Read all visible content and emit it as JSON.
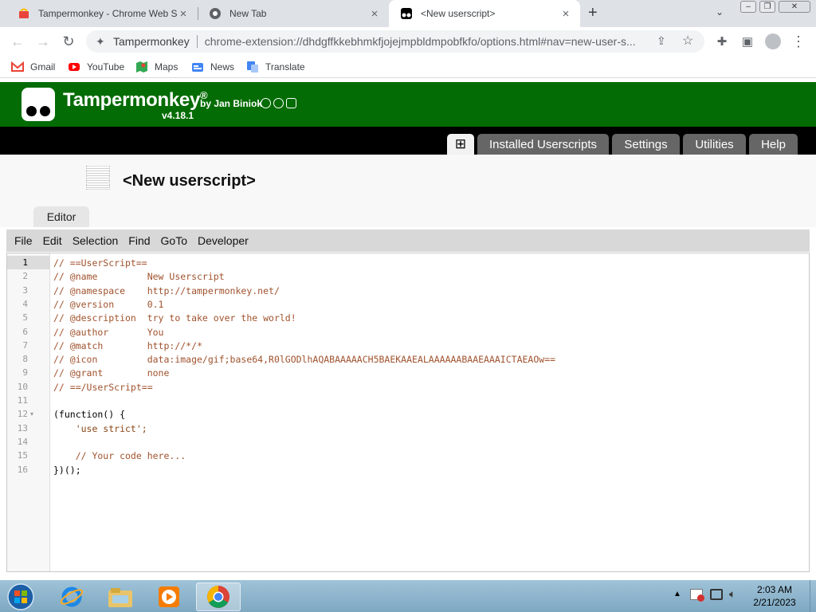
{
  "browser": {
    "tabs": [
      {
        "title": "Tampermonkey - Chrome Web St",
        "icon": "chrome-web-store-icon"
      },
      {
        "title": "New Tab",
        "icon": "chrome-icon"
      },
      {
        "title": "<New userscript>",
        "icon": "tampermonkey-icon",
        "active": true
      }
    ],
    "new_tab_symbol": "+",
    "close_symbol": "×",
    "omnibox": {
      "site": "Tampermonkey",
      "url": "chrome-extension://dhdgffkkebhmkfjojejmpbldmpobfkfo/options.html#nav=new-user-s..."
    },
    "bookmarks": [
      {
        "label": "Gmail",
        "icon": "gmail-icon",
        "color": "#ea4335"
      },
      {
        "label": "YouTube",
        "icon": "youtube-icon",
        "color": "#ff0000"
      },
      {
        "label": "Maps",
        "icon": "maps-icon",
        "color": "#34a853"
      },
      {
        "label": "News",
        "icon": "news-icon",
        "color": "#4285f4"
      },
      {
        "label": "Translate",
        "icon": "translate-icon",
        "color": "#4285f4"
      }
    ]
  },
  "tampermonkey": {
    "brand": "Tampermonkey",
    "registered": "®",
    "author": "by Jan Biniok",
    "version": "v4.18.1",
    "brand_color": "#046c04",
    "nav": {
      "new_symbol": "⊞",
      "items": [
        "Installed Userscripts",
        "Settings",
        "Utilities",
        "Help"
      ]
    },
    "script_title": "<New userscript>",
    "editor_tab": "Editor",
    "menu": [
      "File",
      "Edit",
      "Selection",
      "Find",
      "GoTo",
      "Developer"
    ],
    "code": [
      {
        "line": "1",
        "text": "// ==UserScript==",
        "kind": "comment"
      },
      {
        "line": "2",
        "text": "// @name         New Userscript",
        "kind": "comment"
      },
      {
        "line": "3",
        "text": "// @namespace    http://tampermonkey.net/",
        "kind": "comment"
      },
      {
        "line": "4",
        "text": "// @version      0.1",
        "kind": "comment"
      },
      {
        "line": "5",
        "text": "// @description  try to take over the world!",
        "kind": "comment"
      },
      {
        "line": "6",
        "text": "// @author       You",
        "kind": "comment"
      },
      {
        "line": "7",
        "text": "// @match        http://*/*",
        "kind": "comment"
      },
      {
        "line": "8",
        "text": "// @icon         data:image/gif;base64,R0lGODlhAQABAAAAACH5BAEKAAEALAAAAAABAAEAAAICTAEAOw==",
        "kind": "comment"
      },
      {
        "line": "9",
        "text": "// @grant        none",
        "kind": "comment"
      },
      {
        "line": "10",
        "text": "// ==/UserScript==",
        "kind": "comment"
      },
      {
        "line": "11",
        "text": "",
        "kind": "plain"
      },
      {
        "line": "12",
        "text": "(function() {",
        "kind": "plain",
        "fold": "▾"
      },
      {
        "line": "13",
        "text": "    'use strict';",
        "kind": "str"
      },
      {
        "line": "14",
        "text": "",
        "kind": "plain"
      },
      {
        "line": "15",
        "text": "    // Your code here...",
        "kind": "comment"
      },
      {
        "line": "16",
        "text": "})();",
        "kind": "plain"
      }
    ]
  },
  "taskbar": {
    "time": "2:03 AM",
    "date": "2/21/2023",
    "apps": [
      "start-orb-icon",
      "internet-explorer-icon",
      "file-explorer-icon",
      "media-player-icon",
      "chrome-icon"
    ]
  }
}
